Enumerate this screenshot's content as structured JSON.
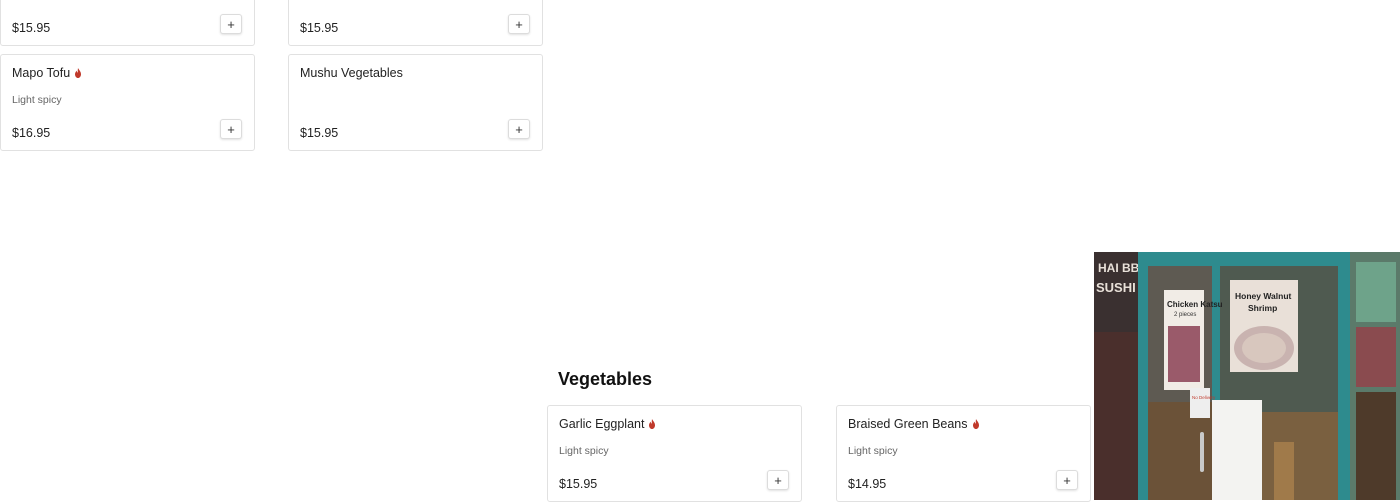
{
  "accent_color": "#c0392b",
  "top_cards": [
    {
      "price": "$15.95"
    },
    {
      "price": "$15.95"
    }
  ],
  "cards_row2": [
    {
      "name": "Mapo Tofu",
      "note": "Light spicy",
      "price": "$16.95",
      "spicy": true
    },
    {
      "name": "Mushu Vegetables",
      "note": "",
      "price": "$15.95",
      "spicy": false
    }
  ],
  "section": {
    "title": "Vegetables"
  },
  "vegetables": [
    {
      "name": "Garlic Eggplant",
      "note": "Light spicy",
      "price": "$15.95",
      "spicy": true
    },
    {
      "name": "Braised Green Beans",
      "note": "Light spicy",
      "price": "$14.95",
      "spicy": true
    }
  ],
  "add_button": {
    "label": "+"
  },
  "restaurant_photo": {
    "sign_text": "HAI BBQ SUSHI",
    "poster_left": "Chicken Katsu",
    "poster_left_sub": "2 pieces",
    "poster_right": "Honey Walnut Shrimp",
    "door_sign": "No Delivery"
  }
}
